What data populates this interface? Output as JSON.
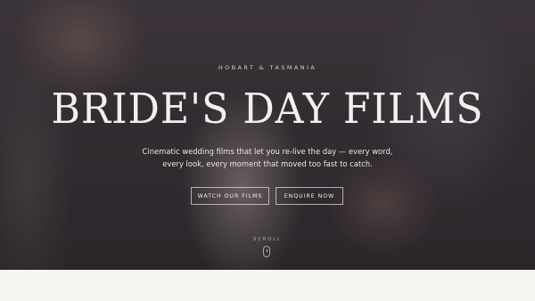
{
  "hero": {
    "eyebrow": "HOBART & TASMANIA",
    "title": "BRIDE'S DAY FILMS",
    "tagline_line1": "Cinematic wedding films that let you re-live the day — every word,",
    "tagline_line2": "every look, every moment that moved too fast to catch.",
    "buttons": {
      "watch_label": "WATCH OUR FILMS",
      "enquire_label": "ENQUIRE NOW"
    },
    "scroll_label": "SCROLL"
  },
  "colors": {
    "overlay": "#3e383d",
    "text_light": "#f4efed",
    "section_bg": "#f6f4f1"
  },
  "icons": {
    "scroll": "mouse-scroll-icon"
  }
}
